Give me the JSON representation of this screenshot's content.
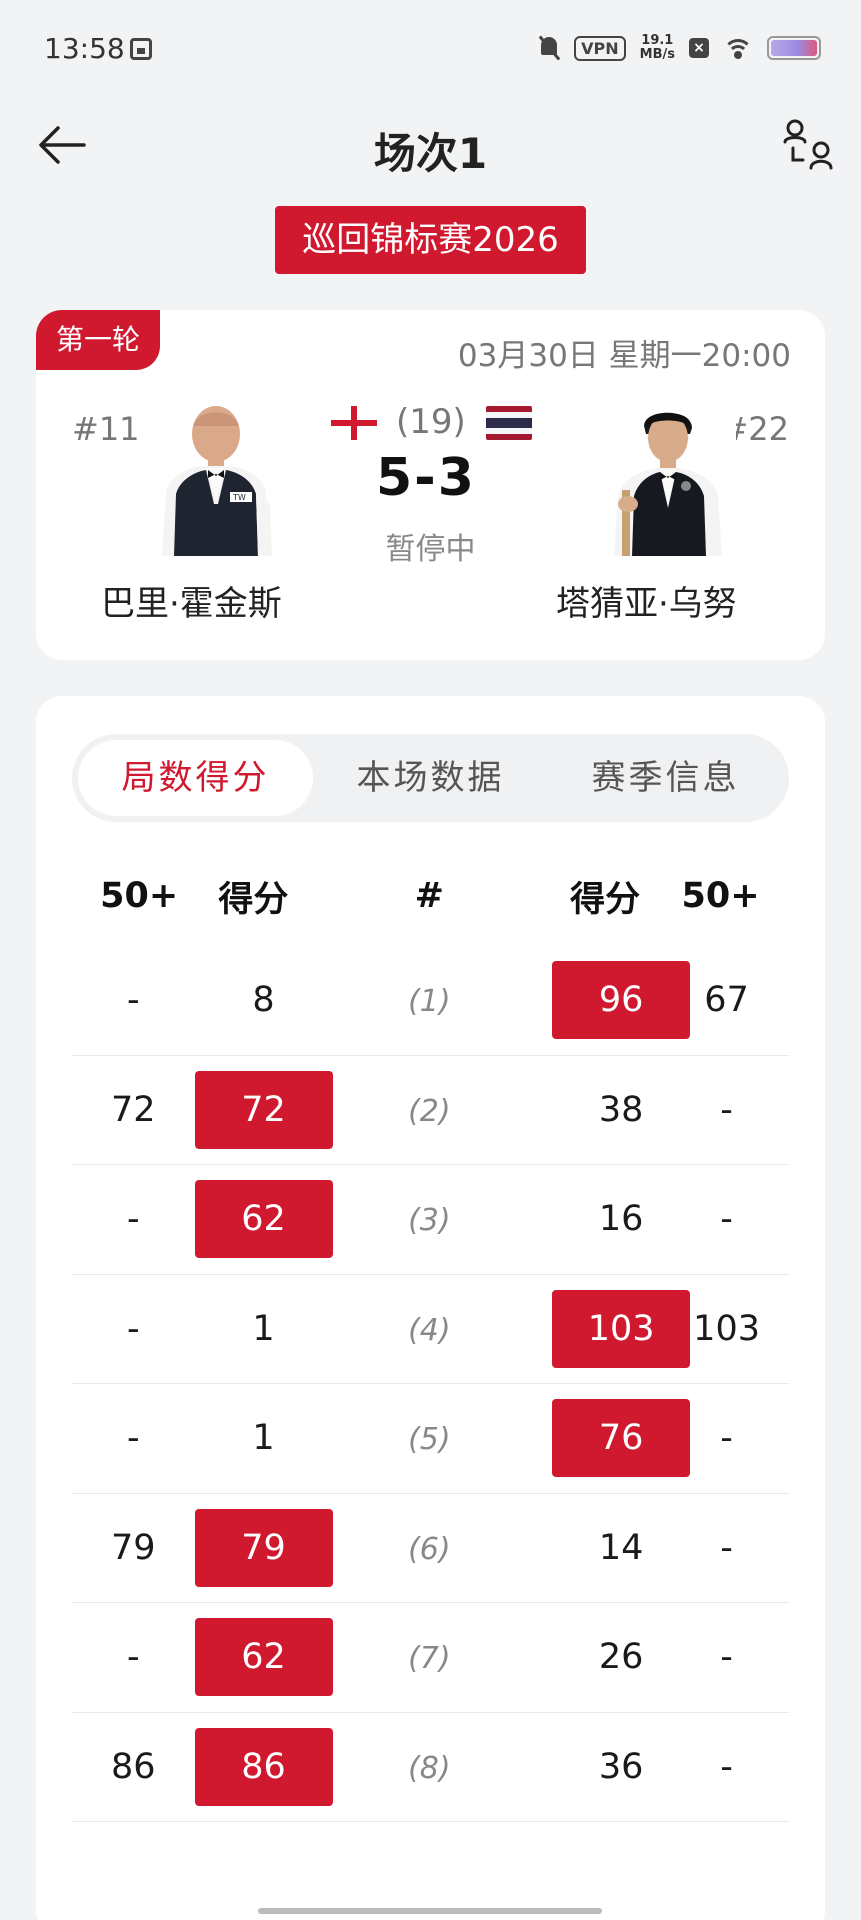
{
  "status_bar": {
    "time": "13:58",
    "vpn": "VPN",
    "speed_value": "19.1",
    "speed_unit": "MB/s"
  },
  "header": {
    "title": "场次1",
    "back_icon": "arrow-left-icon",
    "profile_icon": "switch-player-icon"
  },
  "tournament": "巡回锦标赛2026",
  "match": {
    "round": "第一轮",
    "datetime": "03月30日 星期一20:00",
    "best_of": "(19)",
    "score": "5-3",
    "status": "暂停中",
    "left_player": {
      "seed": "#11",
      "name": "巴里·霍金斯",
      "flag": "england"
    },
    "right_player": {
      "seed": "#22",
      "name": "塔猜亚·乌努",
      "flag": "thailand"
    }
  },
  "tabs": [
    {
      "label": "局数得分",
      "active": true
    },
    {
      "label": "本场数据",
      "active": false
    },
    {
      "label": "赛季信息",
      "active": false
    }
  ],
  "table": {
    "headers": [
      "50+",
      "得分",
      "#",
      "得分",
      "50+"
    ],
    "rows": [
      {
        "l50": "-",
        "lscore": "8",
        "frame": "(1)",
        "rscore": "96",
        "r50": "67",
        "winner": "right"
      },
      {
        "l50": "72",
        "lscore": "72",
        "frame": "(2)",
        "rscore": "38",
        "r50": "-",
        "winner": "left"
      },
      {
        "l50": "-",
        "lscore": "62",
        "frame": "(3)",
        "rscore": "16",
        "r50": "-",
        "winner": "left"
      },
      {
        "l50": "-",
        "lscore": "1",
        "frame": "(4)",
        "rscore": "103",
        "r50": "103",
        "winner": "right"
      },
      {
        "l50": "-",
        "lscore": "1",
        "frame": "(5)",
        "rscore": "76",
        "r50": "-",
        "winner": "right"
      },
      {
        "l50": "79",
        "lscore": "79",
        "frame": "(6)",
        "rscore": "14",
        "r50": "-",
        "winner": "left"
      },
      {
        "l50": "-",
        "lscore": "62",
        "frame": "(7)",
        "rscore": "26",
        "r50": "-",
        "winner": "left"
      },
      {
        "l50": "86",
        "lscore": "86",
        "frame": "(8)",
        "rscore": "36",
        "r50": "-",
        "winner": "left"
      }
    ]
  },
  "colors": {
    "accent": "#d0182f",
    "background": "#f2f3f5"
  }
}
